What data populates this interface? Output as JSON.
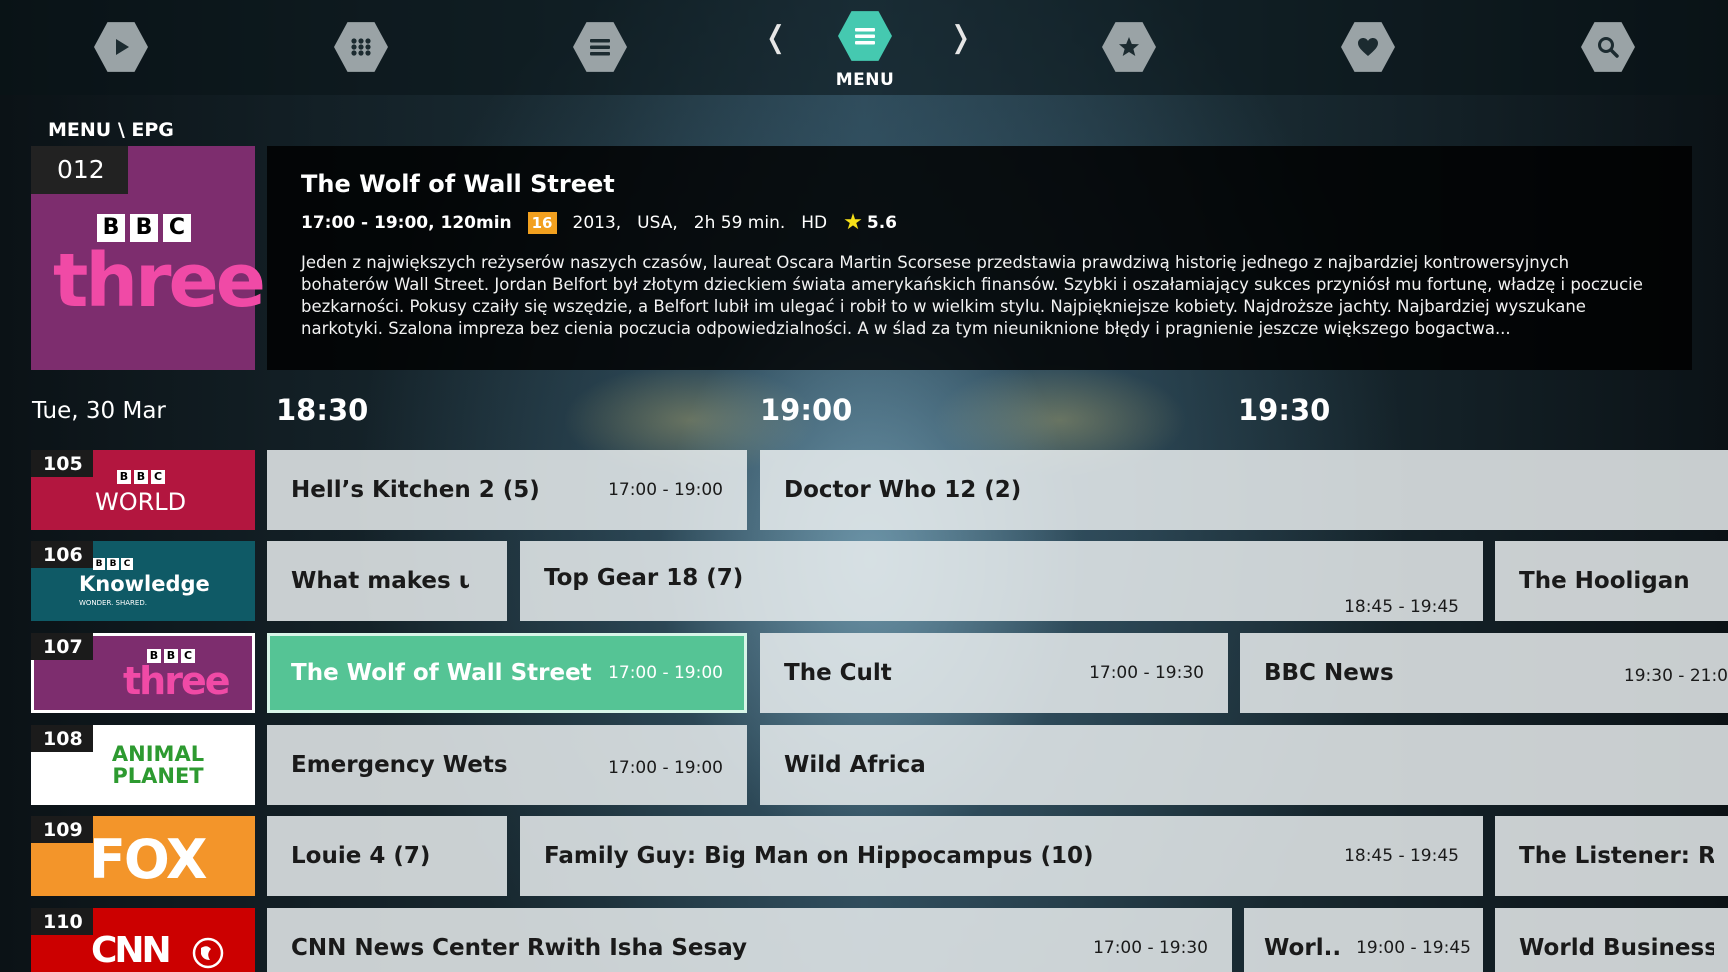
{
  "nav": {
    "items": [
      {
        "name": "play-icon"
      },
      {
        "name": "apps-grid-icon"
      },
      {
        "name": "list-icon"
      },
      {
        "name": "menu-icon",
        "active": true
      },
      {
        "name": "star-icon"
      },
      {
        "name": "heart-icon"
      },
      {
        "name": "search-icon"
      }
    ],
    "prev_arrow": "❬",
    "next_arrow": "❭",
    "active_label": "MENU",
    "accent_color": "#45c9b0"
  },
  "breadcrumb": "MENU \\ EPG",
  "hero": {
    "channel_number": "012",
    "logo_bbc": [
      "B",
      "B",
      "C"
    ],
    "logo_word": "three"
  },
  "detail": {
    "title": "The Wolf of Wall Street",
    "time": "17:00 - 19:00, 120min",
    "age_rating": "16",
    "year": "2013,",
    "country": "USA,",
    "duration": "2h 59 min.",
    "quality": "HD",
    "score": "5.6",
    "description": "Jeden z największych reżyserów naszych czasów, laureat Oscara Martin Scorsese przedstawia prawdziwą historię jednego z najbardziej kontrowersyjnych bohaterów Wall Street. Jordan Belfort był złotym dzieckiem świata amerykańskich finansów. Szybki i oszałamiający sukces przyniósł mu fortunę, władzę i poczucie bezkarności. Pokusy czaiły się wszędzie, a Belfort lubił im ulegać i robił to w wielkim stylu. Najpiękniejsze kobiety. Najdroższe jachty. Najbardziej wyszukane narkotyki. Szalona impreza bez cienia poczucia odpowiedzialności. A w ślad za tym nieuniknione błędy i pragnienie jeszcze większego bogactwa..."
  },
  "timeline": {
    "date": "Tue, 30 Mar",
    "ticks": [
      "18:30",
      "19:00",
      "19:30"
    ]
  },
  "channels": [
    {
      "number": "105",
      "logo_text": "WORLD",
      "logo_bbc": [
        "B",
        "B",
        "C"
      ],
      "color": "#b3163f"
    },
    {
      "number": "106",
      "logo_text": "Knowledge",
      "logo_sub": "WONDER. SHARED.",
      "logo_bbc": [
        "B",
        "B",
        "C"
      ],
      "color": "#0f5a66"
    },
    {
      "number": "107",
      "logo_text": "three",
      "logo_bbc": [
        "B",
        "B",
        "C"
      ],
      "color": "#7d2d6e"
    },
    {
      "number": "108",
      "logo_text": "ANIMAL PLANET",
      "color": "#ffffff"
    },
    {
      "number": "109",
      "logo_text": "FOX",
      "color": "#f3952a"
    },
    {
      "number": "110",
      "logo_text": "CNN",
      "color": "#cc0000"
    }
  ],
  "programs": [
    [
      {
        "title": "Hell’s Kitchen 2 (5)",
        "time": "17:00 - 19:00"
      },
      {
        "title": "Doctor Who 12 (2)",
        "time": ""
      }
    ],
    [
      {
        "title": "What makes us...",
        "time": ""
      },
      {
        "title": "Top Gear 18 (7)",
        "time": "18:45 - 19:45"
      },
      {
        "title": "The Hooligans",
        "time": ""
      }
    ],
    [
      {
        "title": "The Wolf of Wall Street",
        "time": "17:00 - 19:00"
      },
      {
        "title": "The Cult",
        "time": "17:00 - 19:30"
      },
      {
        "title": "BBC News",
        "time": "19:30 - 21:0"
      }
    ],
    [
      {
        "title": "Emergency Wets",
        "time": "17:00 - 19:00"
      },
      {
        "title": "Wild Africa",
        "time": ""
      }
    ],
    [
      {
        "title": "Louie 4 (7)",
        "time": ""
      },
      {
        "title": "Family Guy: Big Man on Hippocampus (10)",
        "time": "18:45 - 19:45"
      },
      {
        "title": "The Listener: Rogue",
        "time": ""
      }
    ],
    [
      {
        "title": "CNN News Center Rwith Isha Sesay",
        "time": "17:00 - 19:30"
      },
      {
        "title": "Worl...",
        "time": "19:00 - 19:45"
      },
      {
        "title": "World Business Tod",
        "time": ""
      }
    ]
  ]
}
